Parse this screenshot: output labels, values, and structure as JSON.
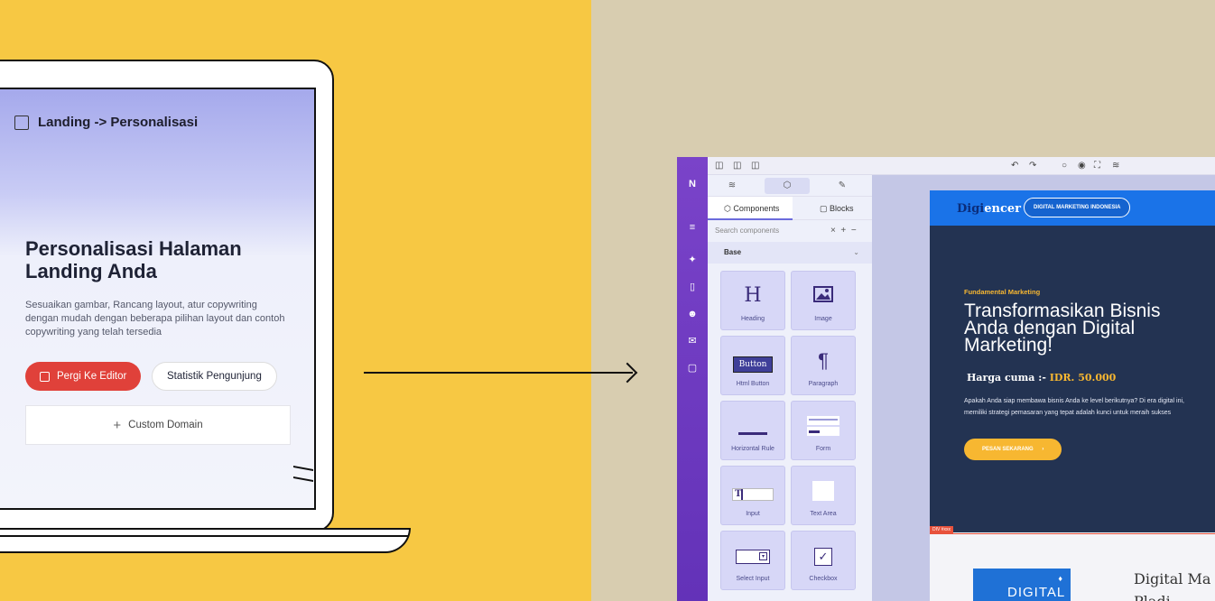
{
  "laptop": {
    "topbar_title": "Landing -> Personalisasi",
    "headline": "Personalisasi Halaman Landing Anda",
    "description": "Sesuaikan gambar, Rancang layout, atur copywriting dengan mudah dengan beberapa pilihan layout dan contoh copywriting yang telah tersedia",
    "editor_button": "Pergi Ke Editor",
    "stats_button": "Statistik Pengunjung",
    "custom_domain": "Custom Domain",
    "custom_domain_icon": "+"
  },
  "editor": {
    "rail_logo": "N",
    "panel_tabs": [
      "layers-icon",
      "components-icon",
      "styles-icon"
    ],
    "subtabs": {
      "components": "Components",
      "blocks": "Blocks"
    },
    "search_placeholder": "Search components",
    "section": "Base",
    "components": [
      {
        "label": "Heading",
        "glyph": "H"
      },
      {
        "label": "Image",
        "glyph": "🖼"
      },
      {
        "label": "Html Button",
        "glyph": "Button"
      },
      {
        "label": "Paragraph",
        "glyph": "¶"
      },
      {
        "label": "Horizontal Rule",
        "glyph": "—"
      },
      {
        "label": "Form",
        "glyph": "☰"
      },
      {
        "label": "Input",
        "glyph": "T|"
      },
      {
        "label": "Text Area",
        "glyph": "▭"
      },
      {
        "label": "Select Input",
        "glyph": "▭▾"
      },
      {
        "label": "Checkbox",
        "glyph": "✓"
      }
    ]
  },
  "preview": {
    "logo_a": "Digi",
    "logo_b": "encer",
    "nav_pill": "DIGITAL MARKETING INDONESIA",
    "eyebrow": "Fundamental Marketing",
    "title": "Transformasikan Bisnis Anda dengan Digital Marketing!",
    "price_label": "Harga cuma :-",
    "price_value": "IDR. 50.000",
    "description": "Apakah Anda siap membawa bisnis Anda ke level berikutnya? Di era digital ini, memiliki strategi pemasaran yang tepat adalah kunci untuk meraih sukses",
    "cta": "PESAN SEKARANG",
    "div_tag": "DIV #xxx",
    "promo_box": "DIGITAL",
    "promo_title_1": "Digital Ma",
    "promo_title_2": "Pladi"
  },
  "colors": {
    "left_bg": "#f7c843",
    "right_bg": "#d8cdb0",
    "accent_red": "#e0413a",
    "rail_purple": "#6f3bc4",
    "preview_blue": "#1a73e8",
    "hero_navy": "#233352",
    "cta_orange": "#f7b731"
  }
}
